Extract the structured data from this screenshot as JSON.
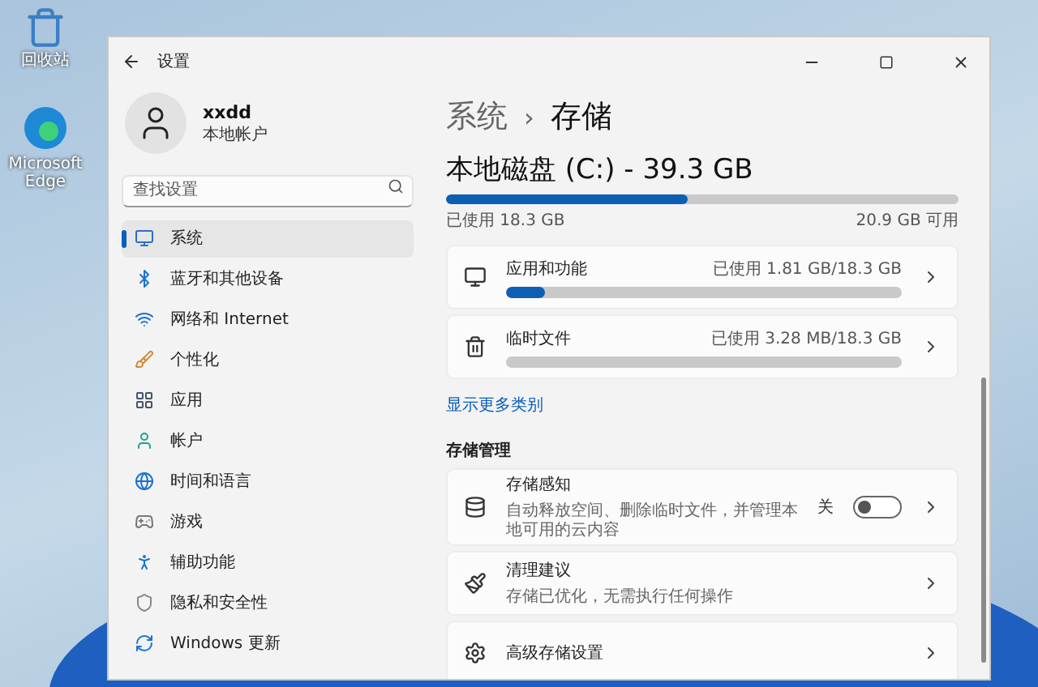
{
  "desktop_icons": [
    "回收站",
    "Microsoft Edge"
  ],
  "window": {
    "title": "设置"
  },
  "account": {
    "name": "xxdd",
    "type": "本地帐户"
  },
  "search": {
    "placeholder": "查找设置"
  },
  "sidebar": {
    "items": [
      {
        "label": "系统",
        "selected": true
      },
      {
        "label": "蓝牙和其他设备",
        "selected": false
      },
      {
        "label": "网络和 Internet",
        "selected": false
      },
      {
        "label": "个性化",
        "selected": false
      },
      {
        "label": "应用",
        "selected": false
      },
      {
        "label": "帐户",
        "selected": false
      },
      {
        "label": "时间和语言",
        "selected": false
      },
      {
        "label": "游戏",
        "selected": false
      },
      {
        "label": "辅助功能",
        "selected": false
      },
      {
        "label": "隐私和安全性",
        "selected": false
      },
      {
        "label": "Windows 更新",
        "selected": false
      }
    ]
  },
  "breadcrumb": {
    "parent": "系统",
    "separator": "›",
    "current": "存储"
  },
  "disk": {
    "title": "本地磁盘 (C:) - 39.3 GB",
    "level": 0.47,
    "used": "已使用 18.3 GB",
    "free": "20.9 GB 可用"
  },
  "categories": [
    {
      "label": "应用和功能",
      "usage": "已使用 1.81 GB/18.3 GB",
      "level": 0.1
    },
    {
      "label": "临时文件",
      "usage": "已使用 3.28 MB/18.3 GB",
      "level": 0.0
    }
  ],
  "more_link": "显示更多类别",
  "management": {
    "heading": "存储管理",
    "items": [
      {
        "kind": "toggle",
        "title": "存储感知",
        "description": "自动释放空间、删除临时文件，并管理本地可用的云内容",
        "state_label": "关",
        "on": false
      },
      {
        "kind": "plain",
        "title": "清理建议",
        "description": "存储已优化，无需执行任何操作"
      },
      {
        "kind": "plain",
        "title": "高级存储设置"
      }
    ]
  }
}
